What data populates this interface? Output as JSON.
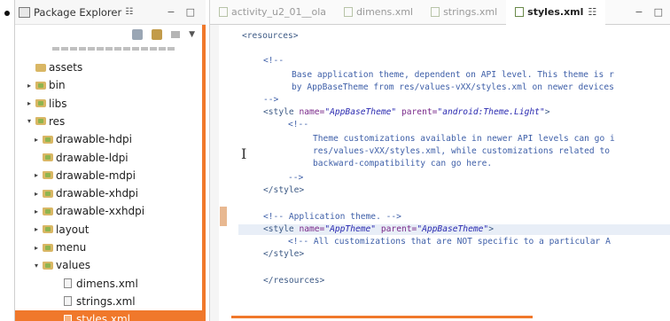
{
  "package_explorer": {
    "title": "Package Explorer",
    "title_suffix": "☷",
    "min_label": "−",
    "max_label": "□",
    "tree": [
      {
        "label": "assets",
        "type": "folder",
        "indent": 0,
        "arrow": ""
      },
      {
        "label": "bin",
        "type": "folder",
        "indent": 0,
        "arrow": "▸"
      },
      {
        "label": "libs",
        "type": "folder",
        "indent": 0,
        "arrow": "▸"
      },
      {
        "label": "res",
        "type": "folder",
        "indent": 0,
        "arrow": "▾"
      },
      {
        "label": "drawable-hdpi",
        "type": "folder",
        "indent": 1,
        "arrow": "▸"
      },
      {
        "label": "drawable-ldpi",
        "type": "folder",
        "indent": 1,
        "arrow": ""
      },
      {
        "label": "drawable-mdpi",
        "type": "folder",
        "indent": 1,
        "arrow": "▸"
      },
      {
        "label": "drawable-xhdpi",
        "type": "folder",
        "indent": 1,
        "arrow": "▸"
      },
      {
        "label": "drawable-xxhdpi",
        "type": "folder",
        "indent": 1,
        "arrow": "▸"
      },
      {
        "label": "layout",
        "type": "folder",
        "indent": 1,
        "arrow": "▸"
      },
      {
        "label": "menu",
        "type": "folder",
        "indent": 1,
        "arrow": "▸"
      },
      {
        "label": "values",
        "type": "folder",
        "indent": 1,
        "arrow": "▾"
      },
      {
        "label": "dimens.xml",
        "type": "file",
        "indent": 2,
        "arrow": ""
      },
      {
        "label": "strings.xml",
        "type": "file",
        "indent": 2,
        "arrow": ""
      },
      {
        "label": "styles.xml",
        "type": "file",
        "indent": 2,
        "arrow": "",
        "selected": true
      }
    ]
  },
  "editor": {
    "tabs": [
      {
        "label": "activity_u2_01__ola",
        "active": false
      },
      {
        "label": "dimens.xml",
        "active": false
      },
      {
        "label": "strings.xml",
        "active": false
      },
      {
        "label": "styles.xml",
        "active": true,
        "suffix": "☷"
      }
    ],
    "min_label": "−",
    "max_label": "□",
    "code": {
      "l1": "<resources>",
      "l2": "<!--",
      "l3": "Base application theme, dependent on API level. This theme is r",
      "l4": "by AppBaseTheme from res/values-vXX/styles.xml on newer devices",
      "l5": "-->",
      "l6_tag": "<style ",
      "l6_a1": "name=",
      "l6_v1": "\"AppBaseTheme\"",
      "l6_a2": " parent=",
      "l6_v2": "\"android:Theme.Light\"",
      "l6_end": ">",
      "l7": "<!--",
      "l8": "Theme customizations available in newer API levels can go i",
      "l9": "res/values-vXX/styles.xml, while customizations related to",
      "l10": "backward-compatibility can go here.",
      "l11": "-->",
      "l12": "</style>",
      "l13": "<!-- Application theme. -->",
      "l14_tag": "<style ",
      "l14_a1": "name=",
      "l14_v1": "\"AppTheme\"",
      "l14_a2": " parent=",
      "l14_v2": "\"AppBaseTheme\"",
      "l14_end": ">",
      "l15": "<!-- All customizations that are NOT specific to a particular A",
      "l16": "</style>",
      "l17": "</resources>"
    }
  },
  "colors": {
    "selection": "#f0782b",
    "tag": "#3d5a85",
    "attribute": "#7a2a8a",
    "value": "#2a2ab0",
    "comment": "#3e5fa8"
  }
}
